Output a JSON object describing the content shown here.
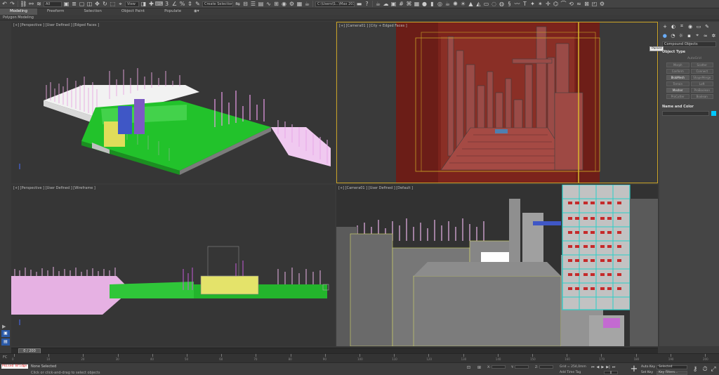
{
  "toolbar": {
    "undo_icon": "undo-icon",
    "redo_icon": "redo-icon",
    "selection_filter": "All",
    "ref_coord": "View",
    "named_selection": "Create Selection Se",
    "workspace": "C:\\Users\\S...\\Max 2016"
  },
  "ribbon": {
    "tabs": [
      "Modeling",
      "Freeform",
      "Selection",
      "Object Paint",
      "Populate"
    ],
    "active_tab": "Modeling",
    "sub_label": "Polygon Modeling"
  },
  "viewports": {
    "top_left": {
      "label": "[+] [Perspective ] [User Defined ] [Edged Faces ]"
    },
    "top_right": {
      "label": "[+] [Camera01 ] [City + Edged Faces ]"
    },
    "bottom_left": {
      "label": "[+] [Perspective ] [User Defined ] [Wireframe ]"
    },
    "bottom_right": {
      "label": "[+] [Camera01 ] [User Defined ] [Default ]"
    }
  },
  "command_panel": {
    "tabs": [
      "+",
      "modify",
      "hierarchy",
      "motion",
      "display",
      "utilities"
    ],
    "tooltip": "Parent",
    "category_dropdown": "Compound Objects",
    "object_type_header": "Object Type",
    "autogrid_label": "AutoGrid",
    "object_buttons": [
      {
        "label": "Morph",
        "on": false
      },
      {
        "label": "Scatter",
        "on": false
      },
      {
        "label": "Conform",
        "on": false
      },
      {
        "label": "Connect",
        "on": false
      },
      {
        "label": "BlobMesh",
        "on": true
      },
      {
        "label": "ShapeMerge",
        "on": false
      },
      {
        "label": "Terrain",
        "on": false
      },
      {
        "label": "Loft",
        "on": false
      },
      {
        "label": "Mesher",
        "on": true
      },
      {
        "label": "ProBoolean",
        "on": false
      },
      {
        "label": "ProCutter",
        "on": false
      },
      {
        "label": "Boolean",
        "on": false
      }
    ],
    "name_color_header": "Name and Color",
    "object_color": "#00c8ff"
  },
  "timeslider": {
    "current": "0 / 200"
  },
  "trackbar": {
    "ticks": [
      "0",
      "10",
      "20",
      "30",
      "40",
      "50",
      "60",
      "70",
      "80",
      "90",
      "100",
      "110",
      "120",
      "130",
      "140",
      "150",
      "160",
      "170",
      "180",
      "190",
      "200"
    ]
  },
  "statusbar": {
    "script_listener": "Poised Bridge",
    "status": "None Selected",
    "prompt": "Click or click-and-drag to select objects",
    "x_label": "X:",
    "y_label": "Y:",
    "z_label": "Z:",
    "grid": "Grid = 254,0mm",
    "add_time_tag": "Add Time Tag",
    "current_frame": "0",
    "auto_key": "Auto Key",
    "set_key": "Set Key",
    "selected_dropdown": "Selected",
    "key_filters": "Key Filters..."
  }
}
